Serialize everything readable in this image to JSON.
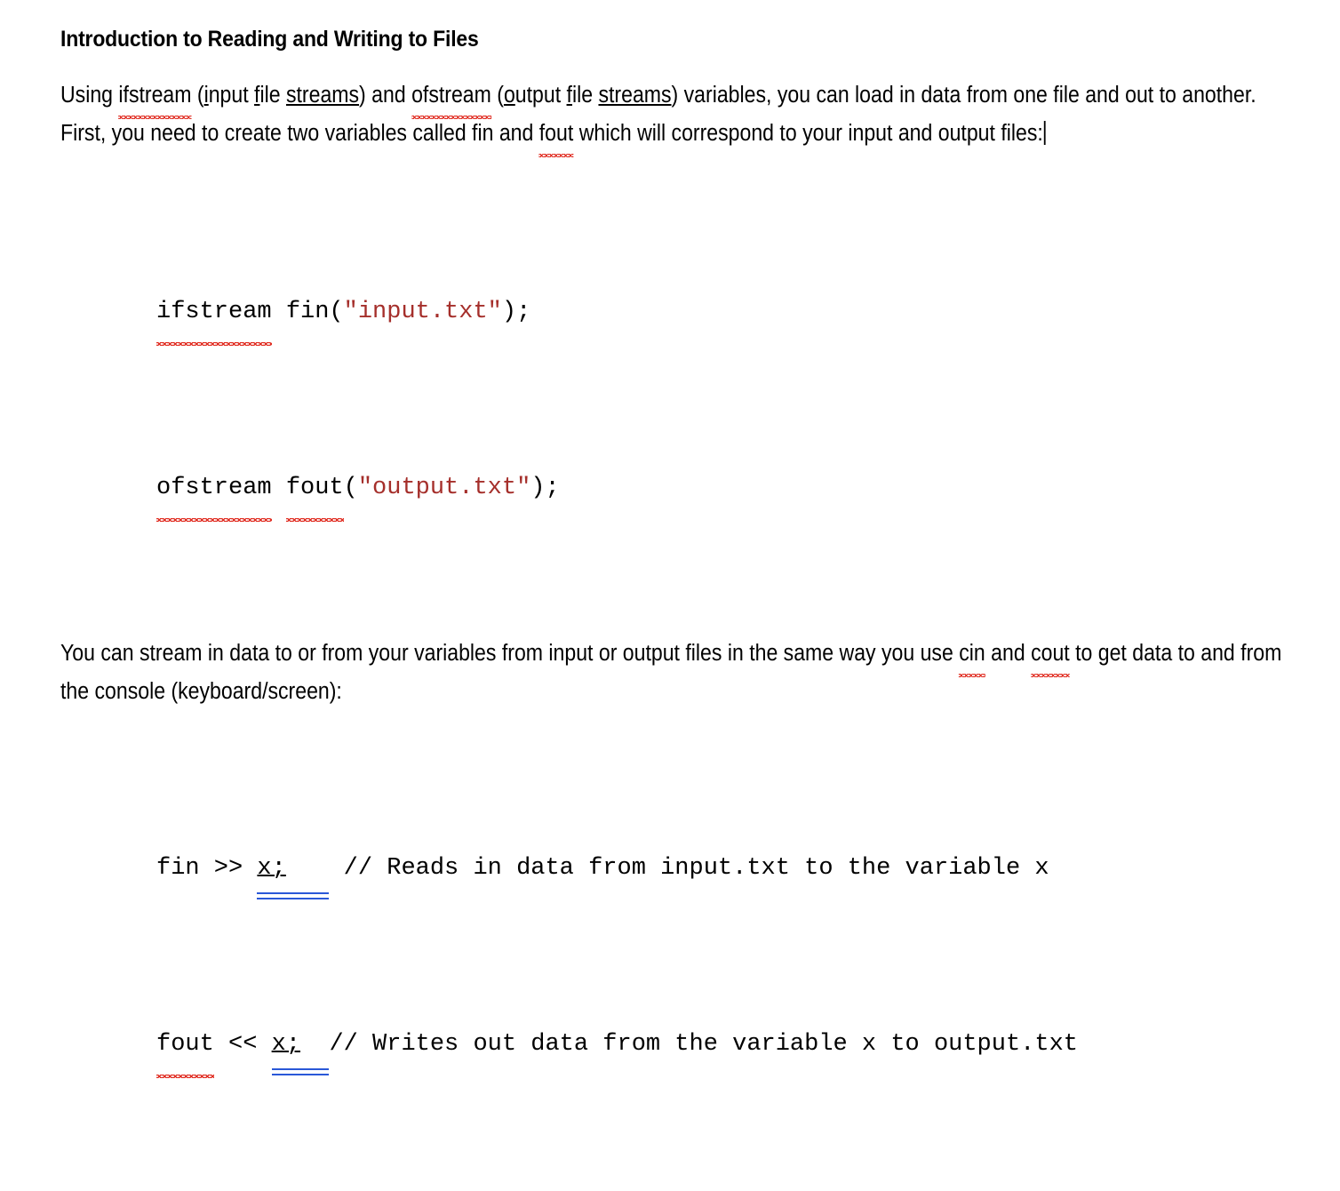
{
  "document": {
    "title": "Introduction to Reading and Writing to Files",
    "paragraph_1": {
      "seg_1": "Using ",
      "seg_ifstream": "ifstream",
      "seg_2": " (",
      "seg_i": "i",
      "seg_3": "nput ",
      "seg_f": "f",
      "seg_4": "ile ",
      "seg_streams1": "streams",
      "seg_5": ") and ",
      "seg_ofstream": "ofstream",
      "seg_6": " (",
      "seg_o": "o",
      "seg_7": "utput ",
      "seg_f2": "f",
      "seg_8": "ile ",
      "seg_streams2": "streams",
      "seg_9": ") variables, you can load in data from one file and out to another. First, you need to create two variables called fin and ",
      "seg_fout": "fout",
      "seg_10": " which will correspond to your input and output files:"
    },
    "code_block_1": {
      "line_1": {
        "keyword": "ifstream",
        "mid": " fin(",
        "string": "\"input.txt\"",
        "end": ");"
      },
      "line_2": {
        "keyword": "ofstream",
        "space": " ",
        "var": "fout",
        "mid": "(",
        "string": "\"output.txt\"",
        "end": ");"
      }
    },
    "paragraph_2": {
      "seg_1": "You can stream in data to or from your variables from input or output files in the same way you use ",
      "seg_cin": "cin",
      "seg_2": " and ",
      "seg_cout": "cout",
      "seg_3": " to get data to and from the console (keyboard/screen):"
    },
    "code_block_2": {
      "line_1": {
        "prefix": "fin >> ",
        "token": "x;",
        "spacer": "   ",
        "comment": " // Reads in data from input.txt to the variable x"
      },
      "line_2": {
        "prefix": "fout",
        "mid": " << ",
        "token": "x;",
        "spacer": "  ",
        "comment": "// Writes out data from the variable x to output.txt"
      }
    },
    "colors": {
      "string_literal": "#a52f2b",
      "spellcheck_underline": "#e02b20",
      "grammar_underline": "#2a58d8",
      "text": "#000000",
      "page_background": "#ffffff"
    }
  }
}
